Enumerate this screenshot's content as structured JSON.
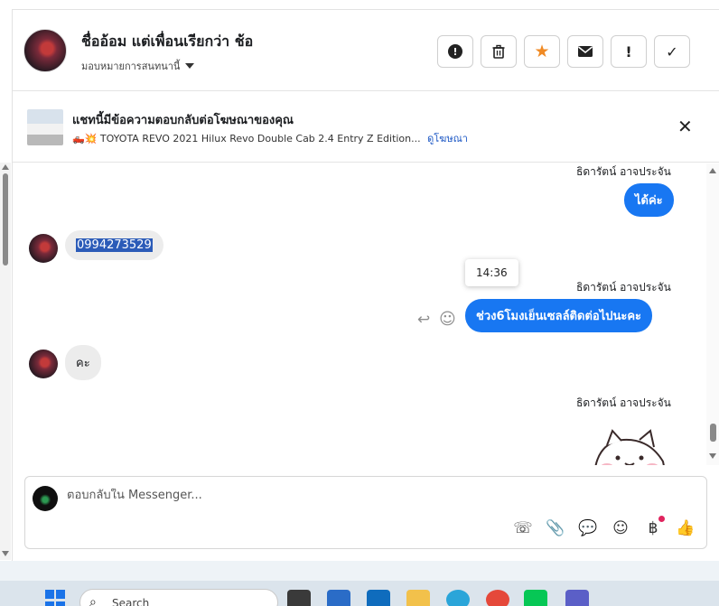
{
  "header": {
    "contact_name": "ชื่ออ้อม แต่เพื่อนเรียกว่า ช้อ",
    "assign_label": "มอบหมายการสนทนานี้",
    "actions": [
      {
        "name": "spam-button",
        "label": "!"
      },
      {
        "name": "delete-button",
        "label": "🗑"
      },
      {
        "name": "star-button",
        "label": "★"
      },
      {
        "name": "mark-unread-button",
        "label": "✉"
      },
      {
        "name": "follow-up-button",
        "label": "!"
      },
      {
        "name": "mark-done-button",
        "label": "✓"
      }
    ]
  },
  "ad": {
    "title": "แชทนี้มีข้อความตอบกลับต่อโฆษณาของคุณ",
    "subtitle": "🛻💥 TOYOTA REVO 2021 Hilux Revo Double Cab 2.4 Entry Z Edition...",
    "link": "ดูโฆษณา",
    "close": "✕"
  },
  "messages": {
    "sender_name": "ธิดารัตน์ อาจประจัน",
    "m1_out": "ได้ค่ะ",
    "m2_in": "0994273529",
    "tooltip_time": "14:36",
    "m3_out": "ช่วง6โมงเย็นเซลล์ติดต่อไปนะคะ",
    "m4_in": "คะ"
  },
  "composer": {
    "placeholder": "ตอบกลับใน Messenger...",
    "tools": [
      {
        "name": "call-add-icon",
        "glyph": "☏"
      },
      {
        "name": "attachment-icon",
        "glyph": "📎"
      },
      {
        "name": "saved-reply-icon",
        "glyph": "💬"
      },
      {
        "name": "emoji-icon",
        "glyph": "☺"
      },
      {
        "name": "payment-icon",
        "glyph": "฿"
      },
      {
        "name": "like-icon",
        "glyph": "👍"
      }
    ]
  },
  "taskbar": {
    "search_label": "Search"
  },
  "colors": {
    "accent": "#1877f2",
    "star": "#f08a24",
    "link": "#1a56c4"
  }
}
